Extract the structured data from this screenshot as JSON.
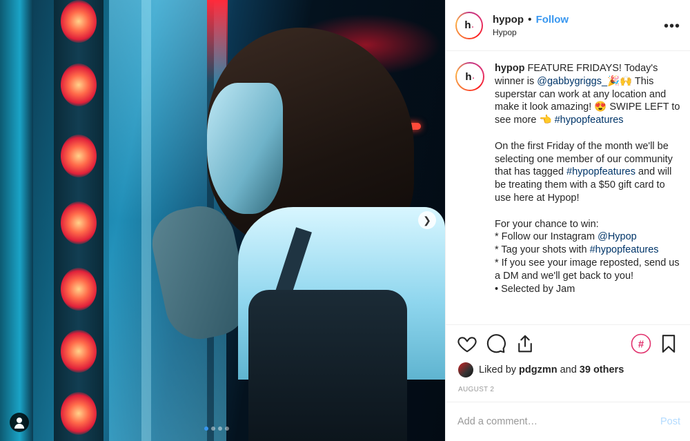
{
  "post": {
    "username": "hypop",
    "follow_label": "Follow",
    "location": "Hypop",
    "avatar_letter": "h",
    "more_label": "•••"
  },
  "caption": {
    "username": "hypop",
    "text_part1": " FEATURE FRIDAYS! Today's winner is ",
    "mention1": "@gabbygriggs_",
    "text_part2": "🎉🙌 This superstar can work at any location and make it look amazing! 😍 SWIPE LEFT to see more 👈 ",
    "hashtag1": "#hypopfeatures",
    "paragraph2_part1": "On the first Friday of the month we'll be selecting one member of our community that has tagged ",
    "hashtag2": "#hypopfeatures",
    "paragraph2_part2": " and will be treating them with a $50 gift card to use here at Hypop!",
    "paragraph3_line1": "For your chance to win:",
    "paragraph3_line2_text": "* Follow our Instagram ",
    "paragraph3_line2_mention": "@Hypop",
    "paragraph3_line3_text": "* Tag your shots with ",
    "paragraph3_line3_hashtag": "#hypopfeatures",
    "paragraph3_line4": "* If you see your image reposted, send us a DM and we'll get back to you!",
    "paragraph3_line5": "• Selected by Jam"
  },
  "likes": {
    "prefix": "Liked by",
    "first_user": "pdgzmn",
    "joiner": "and",
    "others": "39 others"
  },
  "date": "AUGUST 2",
  "comment": {
    "placeholder": "Add a comment…",
    "post_label": "Post"
  },
  "carousel": {
    "total": 4,
    "active_index": 0
  },
  "colors": {
    "link": "#003569",
    "follow": "#3897f0",
    "post_disabled": "#b3dbff",
    "hashtag_ring": "#e1306c"
  }
}
